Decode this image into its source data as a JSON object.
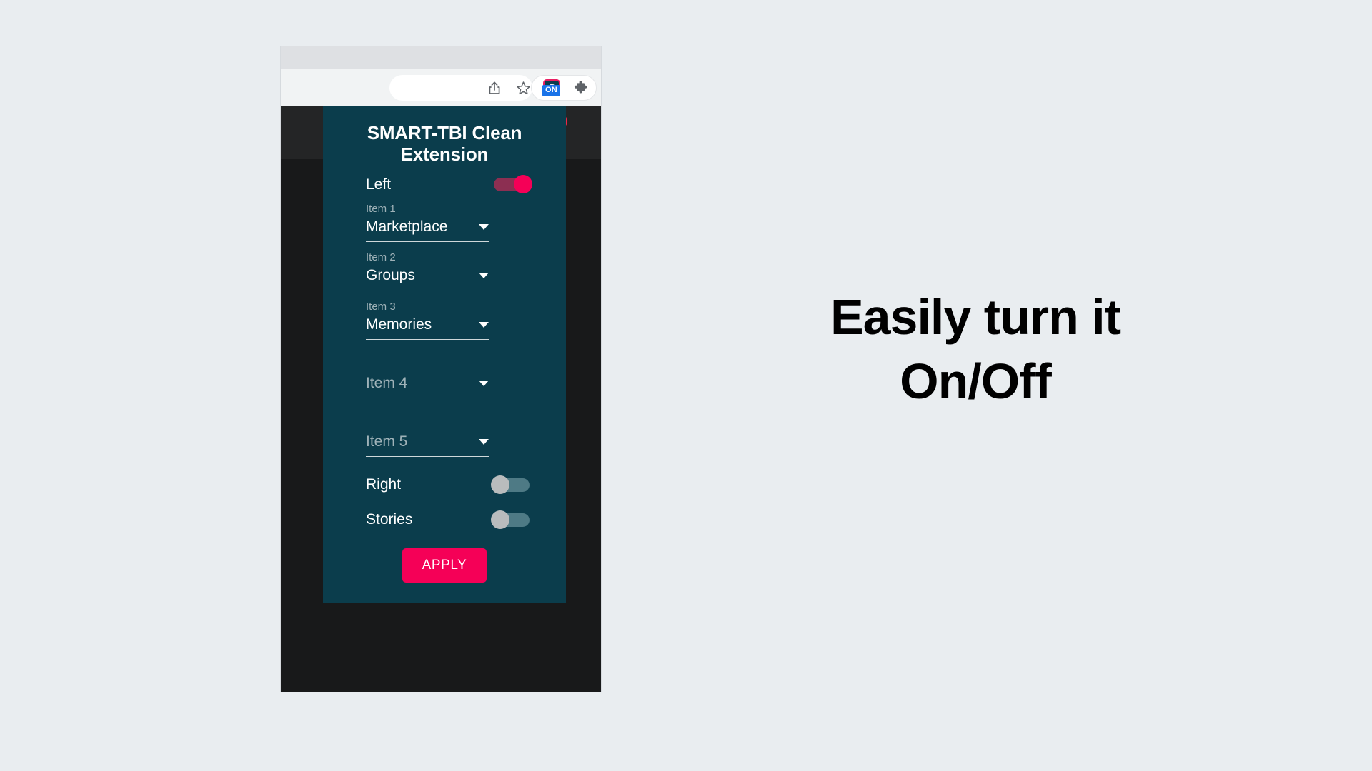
{
  "browser": {
    "toolbar_icons": [
      {
        "name": "share-icon",
        "label": "Share"
      },
      {
        "name": "star-icon",
        "label": "Bookmark"
      },
      {
        "name": "extension-icon",
        "label": "SMART-TBI Clean Extension",
        "glyph": "S",
        "badge": "ON"
      },
      {
        "name": "puzzle-icon",
        "label": "Extensions"
      }
    ]
  },
  "page": {
    "notification_icon": "bell-icon",
    "has_notification_dot": true
  },
  "popup": {
    "title": "SMART-TBI Clean Extension",
    "toggles_top": [
      {
        "label": "Left",
        "state": "on"
      }
    ],
    "fields": [
      {
        "label": "Item 1",
        "value": "Marketplace",
        "is_placeholder": false
      },
      {
        "label": "Item 2",
        "value": "Groups",
        "is_placeholder": false
      },
      {
        "label": "Item 3",
        "value": "Memories",
        "is_placeholder": false
      },
      {
        "label": "",
        "value": "Item 4",
        "is_placeholder": true
      },
      {
        "label": "",
        "value": "Item 5",
        "is_placeholder": true
      }
    ],
    "toggles_bottom": [
      {
        "label": "Right",
        "state": "off"
      },
      {
        "label": "Stories",
        "state": "off"
      }
    ],
    "apply_label": "APPLY",
    "colors": {
      "panel": "#0b3d4c",
      "accent": "#f50057",
      "badge": "#1a73e8"
    }
  },
  "tagline": {
    "line1": "Easily turn it",
    "line2": "On/Off"
  }
}
